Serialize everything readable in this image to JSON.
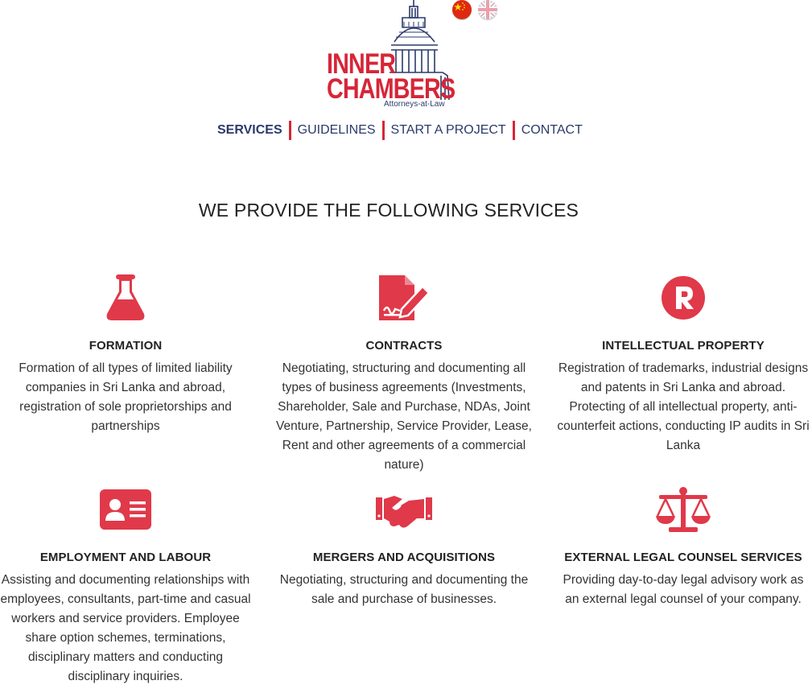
{
  "logo": {
    "line1": "INNER",
    "line2": "CHAMBERS",
    "sub": "Attorneys-at-Law",
    "brand_red": "#d62638",
    "brand_navy": "#2b3a6b"
  },
  "languages": [
    {
      "icon": "china-flag-icon"
    },
    {
      "icon": "uk-flag-icon"
    }
  ],
  "nav": {
    "items": [
      {
        "label": "SERVICES",
        "active": true
      },
      {
        "label": "GUIDELINES"
      },
      {
        "label": "START A PROJECT"
      },
      {
        "label": "CONTACT"
      }
    ]
  },
  "main": {
    "heading": "WE PROVIDE THE FOLLOWING SERVICES",
    "services": [
      {
        "icon": "flask-icon",
        "title": "FORMATION",
        "desc": "Formation of all types of limited liability companies in Sri Lanka and abroad, registration of sole proprietorships and partnerships"
      },
      {
        "icon": "contract-sign-icon",
        "title": "CONTRACTS",
        "desc": "Negotiating, structuring and documenting all types of business agreements (Investments, Shareholder, Sale and Purchase, NDAs, Joint Venture, Partnership, Service Provider, Lease, Rent and other agreements of a commercial nature)"
      },
      {
        "icon": "registered-trademark-icon",
        "title": "INTELLECTUAL PROPERTY",
        "desc": "Registration of trademarks, industrial designs and patents in Sri Lanka and abroad. Protecting of all intellectual property, anti-counterfeit actions, conducting IP audits in Sri Lanka"
      },
      {
        "icon": "id-card-icon",
        "title": "EMPLOYMENT AND LABOUR",
        "desc": "Assisting and documenting relationships with employees, consultants, part-time and casual workers and service providers. Employee share option schemes, terminations, disciplinary matters and conducting disciplinary inquiries."
      },
      {
        "icon": "handshake-icon",
        "title": "MERGERS AND ACQUISITIONS",
        "desc": "Negotiating, structuring and documenting the sale and purchase of businesses."
      },
      {
        "icon": "scales-icon",
        "title": "EXTERNAL LEGAL COUNSEL SERVICES",
        "desc": "Providing day-to-day legal advisory work as an external legal counsel of your company."
      }
    ]
  },
  "colors": {
    "accent": "#d62638",
    "icon": "#e0394a",
    "nav": "#2b3a6b"
  }
}
